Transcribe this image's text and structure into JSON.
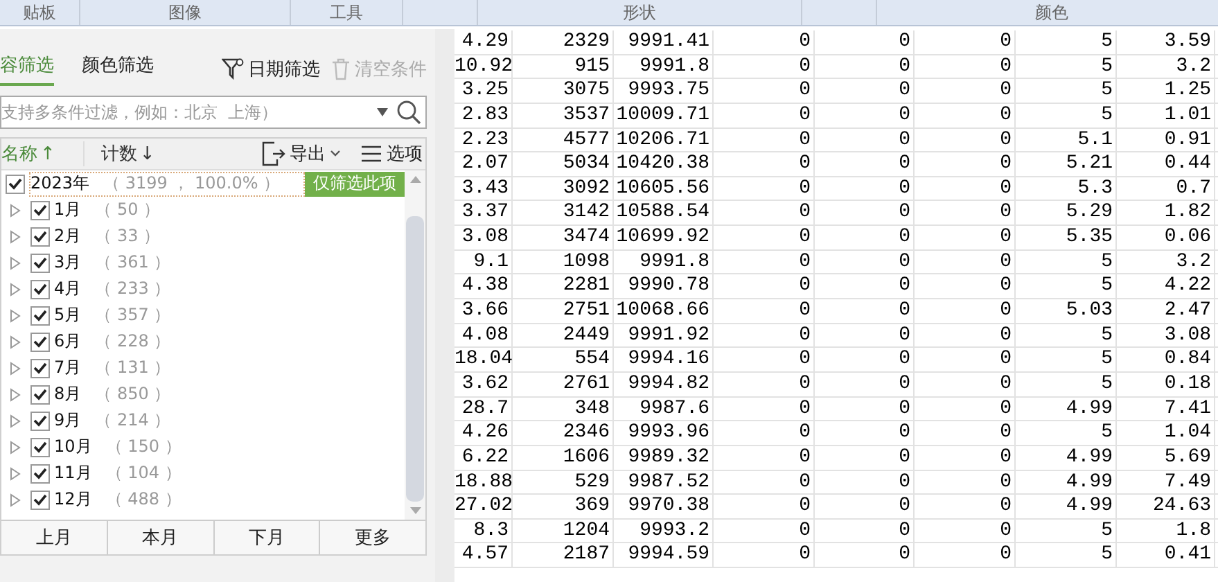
{
  "ribbon": {
    "groups": [
      {
        "label": "贴板"
      },
      {
        "label": "图像"
      },
      {
        "label": "工具"
      },
      {
        "label": "形状"
      },
      {
        "label": "颜色"
      }
    ]
  },
  "filter_panel": {
    "tabs": [
      {
        "label": "容筛选",
        "selected": true
      },
      {
        "label": "颜色筛选",
        "selected": false
      }
    ],
    "tools": [
      {
        "kind": "date",
        "label": "日期筛选",
        "disabled": false
      },
      {
        "kind": "clear",
        "label": "清空条件",
        "disabled": true
      }
    ],
    "search": {
      "placeholder": "支持多条件过滤，例如：北京  上海）"
    },
    "list_header": {
      "sorts": [
        {
          "label": "名称",
          "arrow": "↑",
          "selected": true
        },
        {
          "label": "计数",
          "arrow": "↓",
          "selected": false
        }
      ],
      "actions": [
        {
          "kind": "export",
          "label": "导出"
        },
        {
          "kind": "options",
          "label": "选项"
        }
      ]
    },
    "tree": [
      {
        "label": "2023年",
        "count": "（ 3199 ， 100.0% ）",
        "checked": true,
        "only_button": "仅筛选此项",
        "children": [
          {
            "label": "1月",
            "count": "（ 50 ）",
            "checked": true,
            "expanded": false
          },
          {
            "label": "2月",
            "count": "（ 33 ）",
            "checked": true,
            "expanded": false
          },
          {
            "label": "3月",
            "count": "（ 361 ）",
            "checked": true,
            "expanded": false
          },
          {
            "label": "4月",
            "count": "（ 233 ）",
            "checked": true,
            "expanded": false
          },
          {
            "label": "5月",
            "count": "（ 357 ）",
            "checked": true,
            "expanded": false
          },
          {
            "label": "6月",
            "count": "（ 228 ）",
            "checked": true,
            "expanded": false
          },
          {
            "label": "7月",
            "count": "（ 131 ）",
            "checked": true,
            "expanded": false
          },
          {
            "label": "8月",
            "count": "（ 850 ）",
            "checked": true,
            "expanded": false
          },
          {
            "label": "9月",
            "count": "（ 214 ）",
            "checked": true,
            "expanded": false
          },
          {
            "label": "10月",
            "count": "（ 150 ）",
            "checked": true,
            "expanded": false
          },
          {
            "label": "11月",
            "count": "（ 104 ）",
            "checked": true,
            "expanded": false
          },
          {
            "label": "12月",
            "count": "（ 488 ）",
            "checked": true,
            "expanded": false
          }
        ]
      }
    ],
    "quick_buttons": [
      "上月",
      "本月",
      "下月",
      "更多"
    ]
  },
  "table": {
    "rows": [
      [
        "4.29",
        "2329",
        "9991.41",
        "0",
        "0",
        "0",
        "5",
        "3.59"
      ],
      [
        "10.92",
        "915",
        "9991.8",
        "0",
        "0",
        "0",
        "5",
        "3.2"
      ],
      [
        "3.25",
        "3075",
        "9993.75",
        "0",
        "0",
        "0",
        "5",
        "1.25"
      ],
      [
        "2.83",
        "3537",
        "10009.71",
        "0",
        "0",
        "0",
        "5",
        "1.01"
      ],
      [
        "2.23",
        "4577",
        "10206.71",
        "0",
        "0",
        "0",
        "5.1",
        "0.91"
      ],
      [
        "2.07",
        "5034",
        "10420.38",
        "0",
        "0",
        "0",
        "5.21",
        "0.44"
      ],
      [
        "3.43",
        "3092",
        "10605.56",
        "0",
        "0",
        "0",
        "5.3",
        "0.7"
      ],
      [
        "3.37",
        "3142",
        "10588.54",
        "0",
        "0",
        "0",
        "5.29",
        "1.82"
      ],
      [
        "3.08",
        "3474",
        "10699.92",
        "0",
        "0",
        "0",
        "5.35",
        "0.06"
      ],
      [
        "9.1",
        "1098",
        "9991.8",
        "0",
        "0",
        "0",
        "5",
        "3.2"
      ],
      [
        "4.38",
        "2281",
        "9990.78",
        "0",
        "0",
        "0",
        "5",
        "4.22"
      ],
      [
        "3.66",
        "2751",
        "10068.66",
        "0",
        "0",
        "0",
        "5.03",
        "2.47"
      ],
      [
        "4.08",
        "2449",
        "9991.92",
        "0",
        "0",
        "0",
        "5",
        "3.08"
      ],
      [
        "18.04",
        "554",
        "9994.16",
        "0",
        "0",
        "0",
        "5",
        "0.84"
      ],
      [
        "3.62",
        "2761",
        "9994.82",
        "0",
        "0",
        "0",
        "5",
        "0.18"
      ],
      [
        "28.7",
        "348",
        "9987.6",
        "0",
        "0",
        "0",
        "4.99",
        "7.41"
      ],
      [
        "4.26",
        "2346",
        "9993.96",
        "0",
        "0",
        "0",
        "5",
        "1.04"
      ],
      [
        "6.22",
        "1606",
        "9989.32",
        "0",
        "0",
        "0",
        "4.99",
        "5.69"
      ],
      [
        "18.88",
        "529",
        "9987.52",
        "0",
        "0",
        "0",
        "4.99",
        "7.49"
      ],
      [
        "27.02",
        "369",
        "9970.38",
        "0",
        "0",
        "0",
        "4.99",
        "24.63"
      ],
      [
        "8.3",
        "1204",
        "9993.2",
        "0",
        "0",
        "0",
        "5",
        "1.8"
      ],
      [
        "4.57",
        "2187",
        "9994.59",
        "0",
        "0",
        "0",
        "5",
        "0.41"
      ]
    ]
  }
}
